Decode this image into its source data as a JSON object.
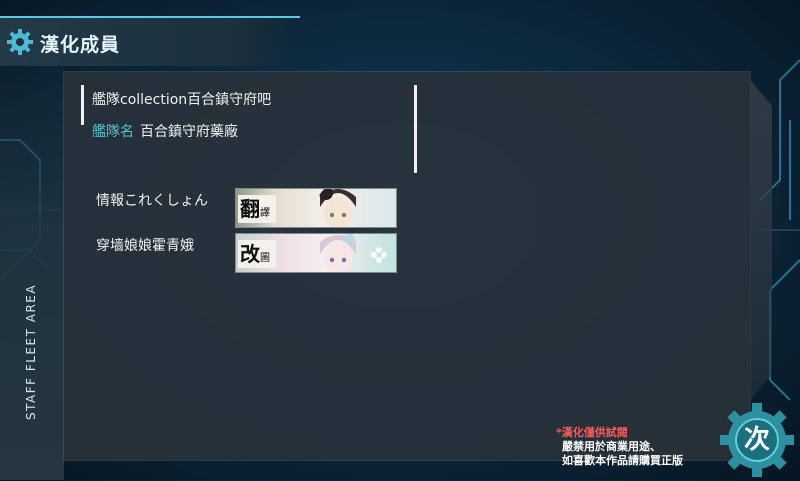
{
  "header": {
    "title": "漢化成員",
    "icon": "gear-icon"
  },
  "side_rail": {
    "label": "STAFF FLEET AREA"
  },
  "info": {
    "group_name": "艦隊collection百合鎮守府吧",
    "fleet_label": "艦隊名",
    "fleet_value": "百合鎮守府藥廠"
  },
  "staff": [
    {
      "name": "情報これくしょん",
      "role_stamp": "翻",
      "role_stamp_small": "譯"
    },
    {
      "name": "穿墙娘娘霍青娥",
      "role_stamp": "改",
      "role_stamp_small": "圖"
    }
  ],
  "disclaimer": {
    "line1": "*漢化僅供試閱",
    "line2": "嚴禁用於商業用途、",
    "line3": "如喜歡本作品請購買正版"
  },
  "next_button": {
    "label": "次"
  },
  "colors": {
    "accent": "#4fc6d0",
    "gear": "#2e8fa0",
    "warning": "#ff5a5a"
  }
}
